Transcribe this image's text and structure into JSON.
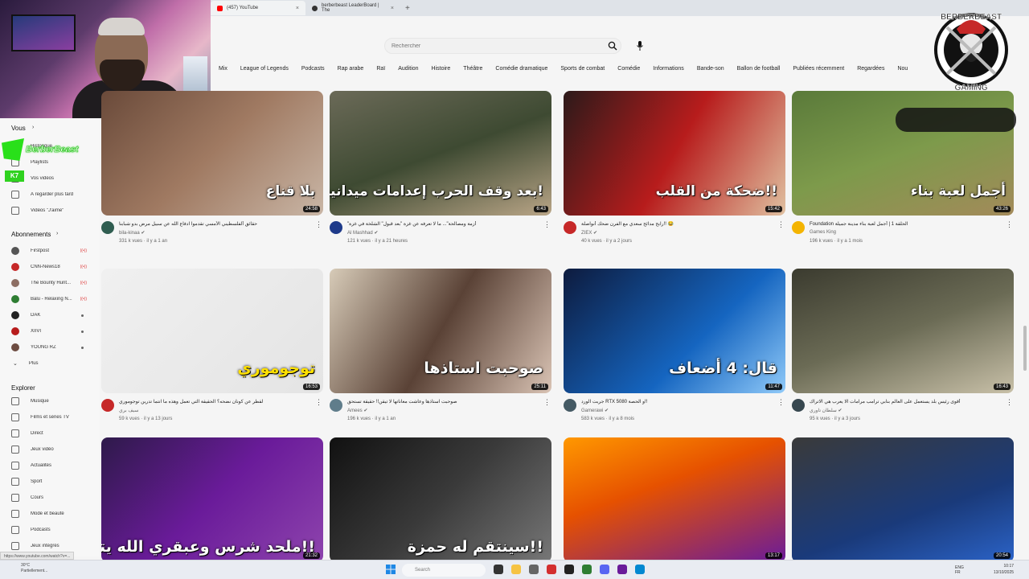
{
  "browser": {
    "tabs": [
      {
        "label": "(457) YouTube",
        "color": "#ff0000",
        "active": true
      },
      {
        "label": "berberbeast LeaderBoard | The",
        "color": "#333333",
        "active": false
      }
    ],
    "new_tab": "+"
  },
  "search": {
    "placeholder": "Rechercher"
  },
  "chips": [
    "Mix",
    "League of Legends",
    "Podcasts",
    "Rap arabe",
    "Raï",
    "Audition",
    "Histoire",
    "Théâtre",
    "Comédie dramatique",
    "Sports de combat",
    "Comédie",
    "Informations",
    "Bande-son",
    "Ballon de football",
    "Publiées récemment",
    "Regardées",
    "Nou"
  ],
  "overlay": {
    "streamer_name": "BerberBeast",
    "logo_top": "BERBERBEAST",
    "logo_bottom": "GAMING",
    "k7": "K7"
  },
  "sidebar": {
    "vous_label": "Vous",
    "vous_items": [
      "Historique",
      "Playlists",
      "Vos vidéos",
      "À regarder plus tard",
      "Vidéos \"J'aime\""
    ],
    "subs_label": "Abonnements",
    "subs": [
      {
        "name": "Firstpost",
        "color": "#555555",
        "live": "((•))"
      },
      {
        "name": "CNN-News18",
        "color": "#c62828",
        "live": "((•))"
      },
      {
        "name": "The Bounty Hunt...",
        "color": "#8d6e63",
        "live": "((•))"
      },
      {
        "name": "Balu - Relaxing N...",
        "color": "#2e7d32",
        "live": "((•))"
      },
      {
        "name": "DAK",
        "color": "#222222",
        "live": ""
      },
      {
        "name": "XIIVI",
        "color": "#b71c1c",
        "live": ""
      },
      {
        "name": "YOUNG RZ",
        "color": "#6d4c41",
        "live": ""
      }
    ],
    "more_label": "Plus",
    "explore_label": "Explorer",
    "explore_items": [
      "Musique",
      "Films et séries TV",
      "Direct",
      "Jeux vidéo",
      "Actualités",
      "Sport",
      "Cours",
      "Mode et beauté",
      "Podcasts",
      "Jeux intégrés"
    ]
  },
  "videos": [
    {
      "title": "حقائق ألفلسطيني الأمسي تقدموا ادفاع الله عن سبيل مرض بدو شبابنا",
      "channel": "bila-kinaa ✔",
      "stats": "331 k vues · il y a 1 an",
      "duration": "24:58",
      "thumb_text": "بلا قناع",
      "bg": "linear-gradient(135deg,#6a4a3a,#a07a62 50,#c9b6a6)",
      "avatar": "#2f5d50"
    },
    {
      "title": "\"أزمة ومصالحة\"... ما لا تعرفه عن غزة \"بعد قبول\" الشلخة في غزة",
      "channel": "Al Mashhad ✔",
      "stats": "121 k vues · il y a 21 heures",
      "duration": "6:43",
      "thumb_text": "بعد وقف الحرب إعدامات ميدانية بغزة!",
      "bg": "linear-gradient(160deg,#6b6a58,#3e4a32 50,#b9a587)",
      "avatar": "#1e3a8a"
    },
    {
      "title": "رابح مدائح سعدي مع الفرن ضحك أنواصلة!! 😂",
      "channel": "ZIEX ✔",
      "stats": "40 k vues · il y a 2 jours",
      "duration": "15:42",
      "thumb_text": "ضحكة من القلب!!",
      "bg": "linear-gradient(120deg,#2c1a1a,#b71c1c 50,#e0c0a0)",
      "avatar": "#c62828"
    },
    {
      "title": "Foundation الحلقة 1 | أجمل لعبة بناء مدينة جميلة",
      "channel": "Games King",
      "stats": "196 k vues · il y a 1 mois",
      "duration": "43:26",
      "thumb_text": "أجمل لعبة بناء",
      "bg": "linear-gradient(160deg,#5a7a3a,#7d9a4b 50,#a38a5a)",
      "avatar": "#f4b400"
    },
    {
      "title": "لقطر عن كونان نضحه؟ الحقيقة التي تعمل وهذه ما انتما تدرين توجوموري",
      "channel": "سيف بري",
      "stats": "59 k vues · il y a 13 jours",
      "duration": "16:53",
      "thumb_text": "توجوموري",
      "bg": "linear-gradient(135deg,#f0f0f0,#e4e4e4)",
      "avatar": "#c62828"
    },
    {
      "title": "صوحبت استاذها وعاشت معاناتها لا تيقن!! حقيقة تستحق",
      "channel": "Amees ✔",
      "stats": "196 k vues · il y a 1 an",
      "duration": "25:11",
      "thumb_text": "صوحبت استاذها",
      "bg": "linear-gradient(120deg,#d7cbb8,#5a4236 50,#d9c3b4)",
      "avatar": "#607d8b"
    },
    {
      "title": "جربت الورد RTX 5080 و الحصة!!",
      "channel": "Gamerawi ✔",
      "stats": "583 k vues · il y a 8 mois",
      "duration": "11:47",
      "thumb_text": "قال: 4 أضعاف",
      "bg": "linear-gradient(135deg,#0d1b3e,#1565c0 60,#90caf9)",
      "avatar": "#455a64"
    },
    {
      "title": "أقوى رئيس بلد يستعمل على العالم بنابي ترامب مرامات الا يعرب هي الاتراك",
      "channel": "سلطان تاوري ✔",
      "stats": "95 k vues · il y a 3 jours",
      "duration": "16:43",
      "thumb_text": "",
      "bg": "linear-gradient(160deg,#3b3b2f,#6b6b55 50,#c8c0a8)",
      "avatar": "#37474f"
    },
    {
      "title": "",
      "channel": "",
      "stats": "",
      "duration": "21:32",
      "thumb_text": "ملحد شرس وعبقري الله يتمتع بتعذيبنا؟! طارت الجبهة!!",
      "bg": "linear-gradient(135deg,#2e1a4a,#6a1b9a 50,#8e44ad)",
      "avatar": "#6a1b9a"
    },
    {
      "title": "",
      "channel": "",
      "stats": "",
      "duration": "",
      "thumb_text": "سينتقم له حمزة!!",
      "bg": "linear-gradient(135deg,#111,#3a3a3a 50,#777)",
      "avatar": "#333"
    },
    {
      "title": "",
      "channel": "",
      "stats": "",
      "duration": "13:17",
      "thumb_text": "",
      "bg": "linear-gradient(160deg,#ff9800,#e65100 40,#6a1b9a)",
      "avatar": "#e65100"
    },
    {
      "title": "",
      "channel": "",
      "stats": "",
      "duration": "20:54",
      "thumb_text": "",
      "bg": "linear-gradient(160deg,#3a3a3a,#1a3a7a 60,#2b63c7)",
      "avatar": "#1565c0"
    }
  ],
  "taskbar": {
    "weather_temp": "30°C",
    "weather_desc": "Partiellement...",
    "search_label": "Search",
    "tray_lang": "ENG",
    "tray_lang2": "FR",
    "time": "10:17",
    "date": "13/10/2025"
  },
  "url_tip": "https://www.youtube.com/watch?v=..."
}
